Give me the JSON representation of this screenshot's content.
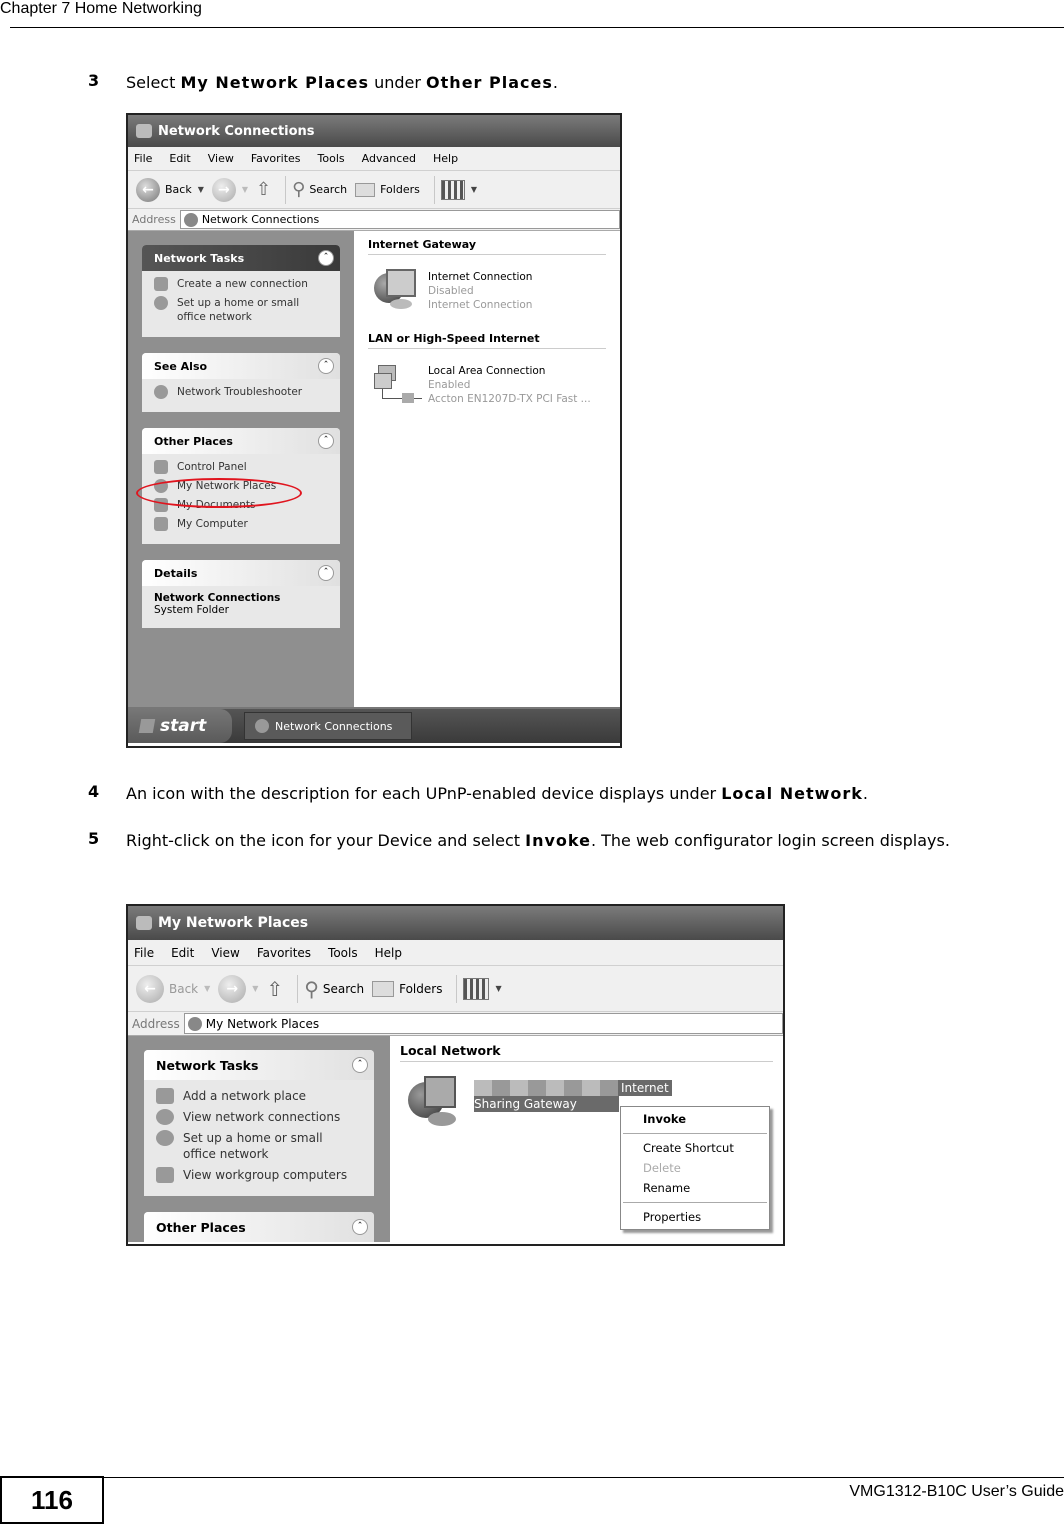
{
  "header": {
    "chapter": "Chapter 7 Home Networking"
  },
  "steps": [
    {
      "num": "3",
      "parts": [
        "Select ",
        "My Network Places",
        " under ",
        "Other Places",
        "."
      ]
    },
    {
      "num": "4",
      "parts": [
        "An icon with the description for each UPnP-enabled device displays under ",
        "Local Network",
        "."
      ]
    },
    {
      "num": "5",
      "parts": [
        "Right-click on the icon for your Device and select ",
        "Invoke",
        ". The web configurator login screen displays."
      ]
    }
  ],
  "screenshot1": {
    "title": "Network Connections",
    "menu": [
      "File",
      "Edit",
      "View",
      "Favorites",
      "Tools",
      "Advanced",
      "Help"
    ],
    "toolbar": {
      "back": "Back",
      "search": "Search",
      "folders": "Folders"
    },
    "address": {
      "label": "Address",
      "value": "Network Connections"
    },
    "panels": {
      "network_tasks": {
        "title": "Network Tasks",
        "items": [
          "Create a new connection",
          "Set up a home or small office network"
        ]
      },
      "see_also": {
        "title": "See Also",
        "items": [
          "Network Troubleshooter"
        ]
      },
      "other_places": {
        "title": "Other Places",
        "items": [
          "Control Panel",
          "My Network Places",
          "My Documents",
          "My Computer"
        ],
        "highlighted": "My Network Places",
        "highlight_color": "#e0141e"
      },
      "details": {
        "title": "Details",
        "name": "Network Connections",
        "type": "System Folder"
      }
    },
    "sections": [
      {
        "title": "Internet Gateway",
        "entry": {
          "name": "Internet Connection",
          "status": "Disabled",
          "desc": "Internet Connection"
        }
      },
      {
        "title": "LAN or High-Speed Internet",
        "entry": {
          "name": "Local Area Connection",
          "status": "Enabled",
          "desc": "Accton EN1207D-TX PCI Fast ..."
        }
      }
    ],
    "taskbar": {
      "start": "start",
      "task": "Network Connections"
    }
  },
  "screenshot2": {
    "title": "My Network Places",
    "menu": [
      "File",
      "Edit",
      "View",
      "Favorites",
      "Tools",
      "Help"
    ],
    "toolbar": {
      "back": "Back",
      "search": "Search",
      "folders": "Folders"
    },
    "address": {
      "label": "Address",
      "value": "My Network Places"
    },
    "panels": {
      "network_tasks": {
        "title": "Network Tasks",
        "items": [
          "Add a network place",
          "View network connections",
          "Set up a home or small office network",
          "View workgroup computers"
        ]
      },
      "other_places": {
        "title": "Other Places"
      }
    },
    "section": {
      "title": "Local Network",
      "device_line1": "Internet",
      "device_line2": "Sharing Gateway"
    },
    "context_menu": {
      "items": [
        "Invoke",
        "Create Shortcut",
        "Delete",
        "Rename",
        "Properties"
      ],
      "default": "Invoke",
      "disabled": "Delete"
    }
  },
  "footer": {
    "page": "116",
    "guide": "VMG1312-B10C User’s Guide"
  }
}
